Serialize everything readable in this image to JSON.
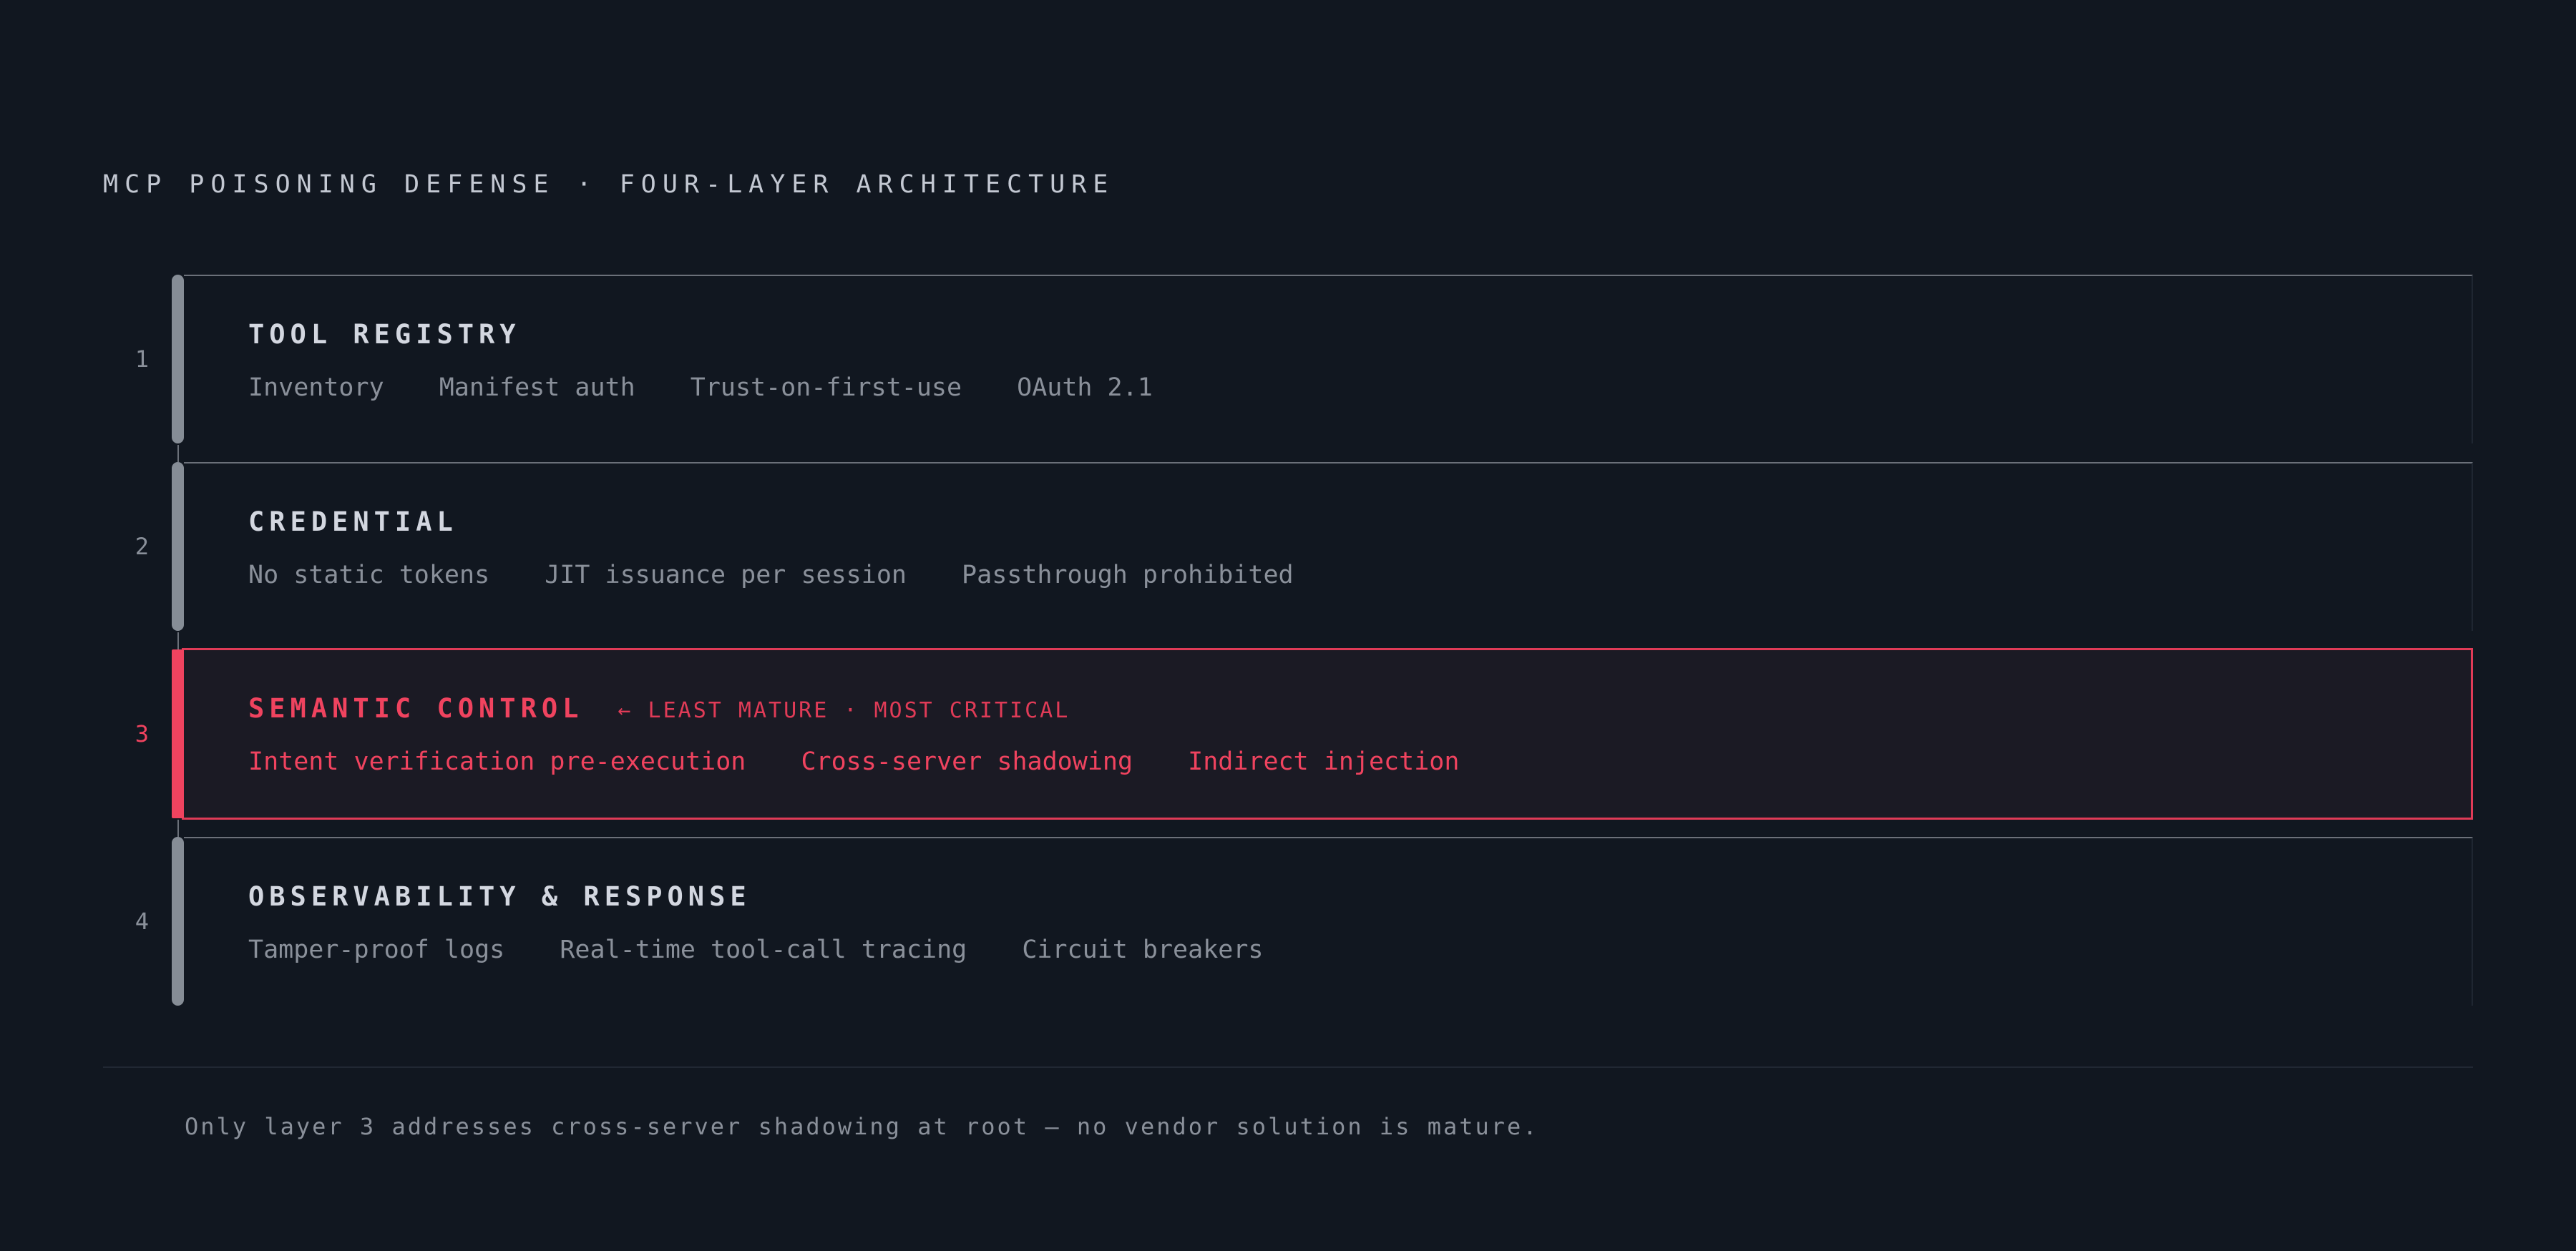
{
  "title": "MCP POISONING DEFENSE · FOUR-LAYER ARCHITECTURE",
  "colors": {
    "background": "#111720",
    "accent": "#f0435f",
    "muted": "#8a909a",
    "bar": "#868d96",
    "heading": "#d3d7e0"
  },
  "layers": [
    {
      "number": "1",
      "name": "TOOL REGISTRY",
      "tag": "",
      "items": [
        "Inventory",
        "Manifest auth",
        "Trust-on-first-use",
        "OAuth 2.1"
      ]
    },
    {
      "number": "2",
      "name": "CREDENTIAL",
      "tag": "",
      "items": [
        "No static tokens",
        "JIT issuance per session",
        "Passthrough prohibited"
      ]
    },
    {
      "number": "3",
      "name": "SEMANTIC CONTROL",
      "tag": "← LEAST MATURE · MOST CRITICAL",
      "highlighted": true,
      "items": [
        "Intent verification pre-execution",
        "Cross-server shadowing",
        "Indirect injection"
      ]
    },
    {
      "number": "4",
      "name": "OBSERVABILITY & RESPONSE",
      "tag": "",
      "items": [
        "Tamper-proof logs",
        "Real-time tool-call tracing",
        "Circuit breakers"
      ]
    }
  ],
  "footnote": "Only layer 3 addresses cross-server shadowing at root — no vendor solution is mature."
}
